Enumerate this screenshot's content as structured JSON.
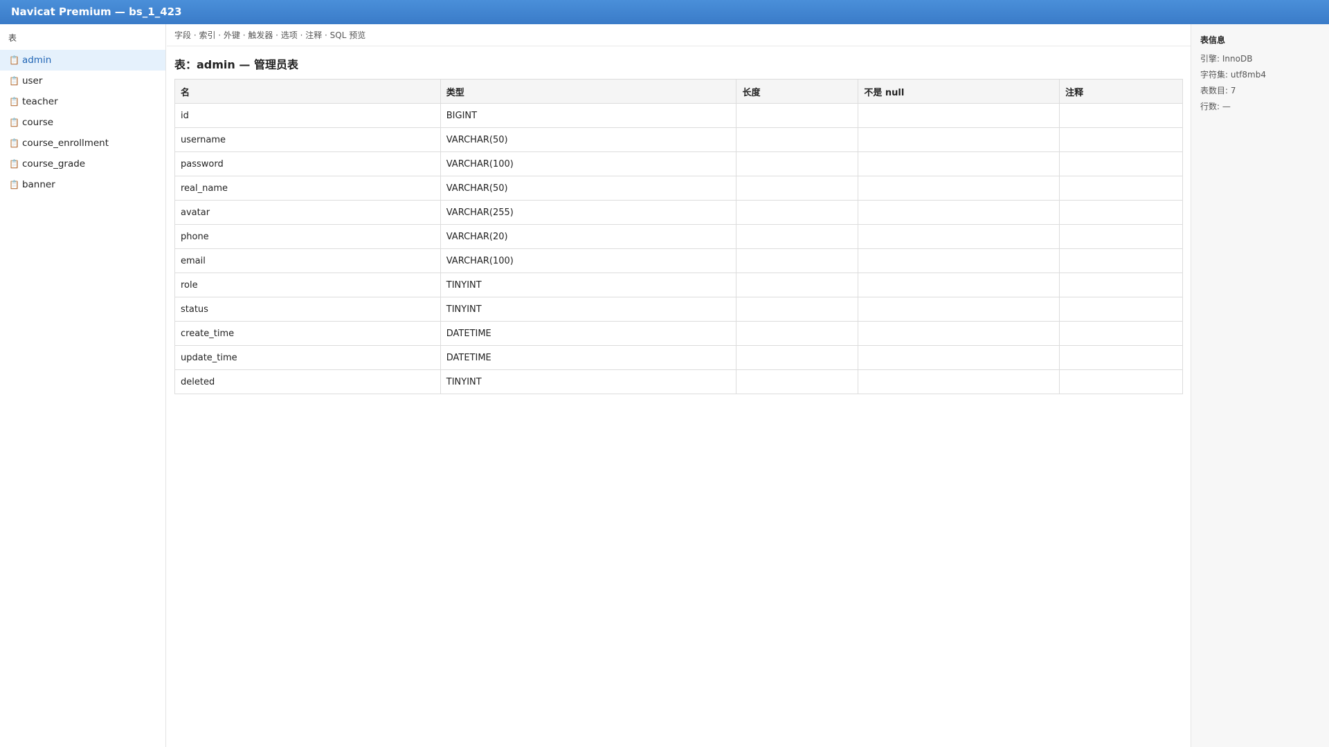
{
  "window": {
    "title": "Navicat Premium — bs_1_423"
  },
  "sidebar": {
    "header": "表",
    "items": [
      {
        "label": "admin",
        "icon": "table-icon"
      },
      {
        "label": "user",
        "icon": "table-icon"
      },
      {
        "label": "teacher",
        "icon": "table-icon"
      },
      {
        "label": "course",
        "icon": "table-icon"
      },
      {
        "label": "course_enrollment",
        "icon": "table-icon"
      },
      {
        "label": "course_grade",
        "icon": "table-icon"
      },
      {
        "label": "banner",
        "icon": "table-icon"
      }
    ],
    "selected": "admin"
  },
  "main": {
    "tabs": "字段 · 索引 · 外键 · 触发器 · 选项 · 注释 · SQL 预览",
    "title": "表：admin — 管理员表",
    "columns": [
      "名",
      "类型",
      "长度",
      "不是 null",
      "注释"
    ],
    "rows": [
      [
        "id",
        "BIGINT",
        "",
        "",
        ""
      ],
      [
        "username",
        "VARCHAR(50)",
        "",
        "",
        ""
      ],
      [
        "password",
        "VARCHAR(100)",
        "",
        "",
        ""
      ],
      [
        "real_name",
        "VARCHAR(50)",
        "",
        "",
        ""
      ],
      [
        "avatar",
        "VARCHAR(255)",
        "",
        "",
        ""
      ],
      [
        "phone",
        "VARCHAR(20)",
        "",
        "",
        ""
      ],
      [
        "email",
        "VARCHAR(100)",
        "",
        "",
        ""
      ],
      [
        "role",
        "TINYINT",
        "",
        "",
        ""
      ],
      [
        "status",
        "TINYINT",
        "",
        "",
        ""
      ],
      [
        "create_time",
        "DATETIME",
        "",
        "",
        ""
      ],
      [
        "update_time",
        "DATETIME",
        "",
        "",
        ""
      ],
      [
        "deleted",
        "TINYINT",
        "",
        "",
        ""
      ]
    ]
  },
  "info": {
    "title": "表信息",
    "engine": "引擎: InnoDB",
    "charset": "字符集: utf8mb4",
    "table_count": "表数目: 7",
    "rows": "行数: —"
  },
  "colors": {
    "titlebar": "#3a7bc8",
    "selected_bg": "#e5f1fc",
    "selected_text": "#1f64b4"
  }
}
